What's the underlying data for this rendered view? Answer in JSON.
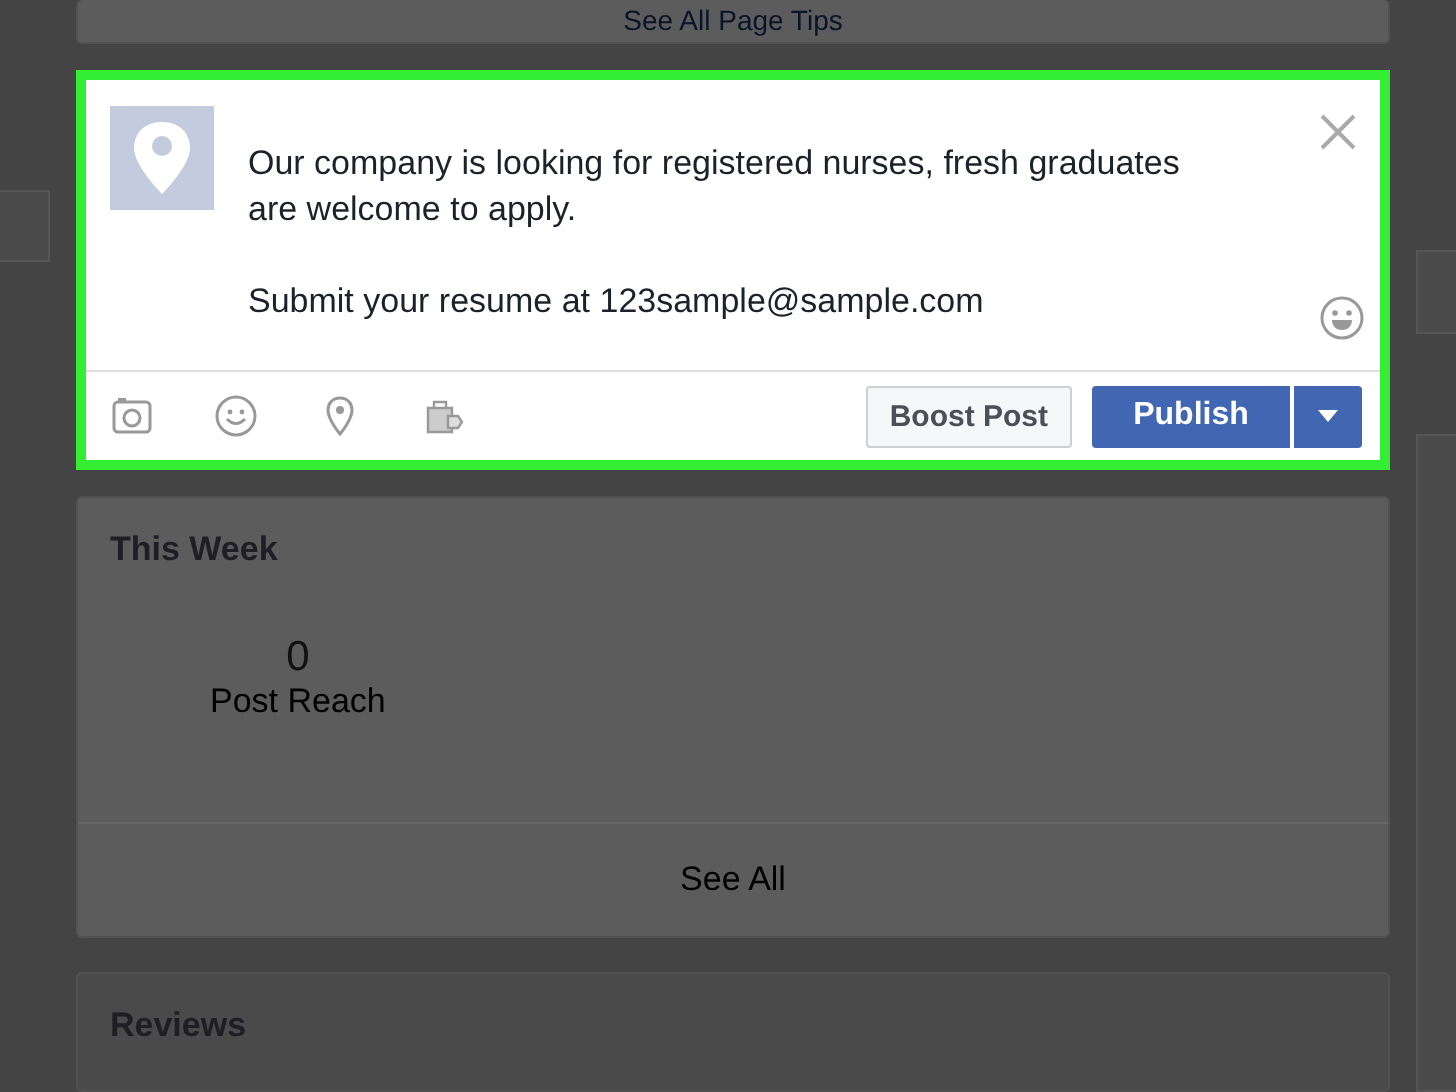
{
  "tips_card": {
    "link": "See All Page Tips"
  },
  "composer": {
    "highlighted": true,
    "paragraphs": [
      "Our company is looking for registered nurses, fresh graduates are welcome to apply.",
      "Submit your resume at 123sample@sample.com"
    ],
    "buttons": {
      "boost": "Boost Post",
      "publish": "Publish"
    }
  },
  "this_week": {
    "title": "This Week",
    "stats": [
      {
        "value": "0",
        "label": "Post Reach"
      }
    ],
    "link": "See All"
  },
  "reviews": {
    "title": "Reviews"
  }
}
